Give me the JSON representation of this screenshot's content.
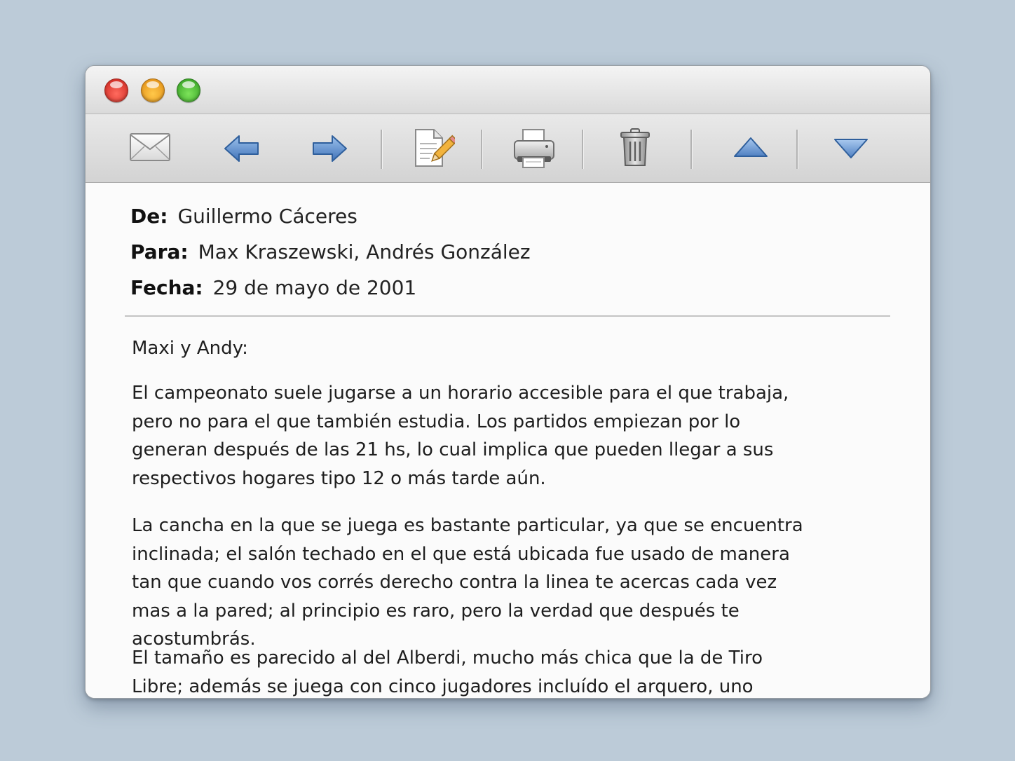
{
  "toolbar": {
    "icons": [
      "mail-icon",
      "arrow-left-icon",
      "arrow-right-icon",
      "compose-icon",
      "printer-icon",
      "trash-icon",
      "arrow-up-icon",
      "arrow-down-icon"
    ]
  },
  "header": {
    "from_label": "De:",
    "from_value": "Guillermo Cáceres",
    "to_label": "Para:",
    "to_value": "Max Kraszewski, Andrés González",
    "date_label": "Fecha:",
    "date_value": "29 de mayo de 2001"
  },
  "message": {
    "greeting": "Maxi y Andy:",
    "paragraphs": [
      "El campeonato suele jugarse a un horario accesible para el que trabaja, pero no para el que también estudia. Los partidos empiezan por lo generan después de las 21 hs, lo cual implica que pueden llegar a sus respectivos hogares tipo 12 o más tarde aún.",
      "La cancha en la que se juega es bastante particular, ya que se encuentra inclinada; el salón techado en el que está ubicada fue usado de manera tan que cuando vos corrés derecho contra la linea te acercas cada vez mas a la pared; al principio es raro, pero la verdad que después te acostumbrás.",
      "El tamaño es parecido al del Alberdi, mucho más chica que la de Tiro Libre; además se juega con cinco jugadores incluído el arquero, uno menos"
    ]
  },
  "colors": {
    "background": "#bccbd8",
    "window": "#fbfbfb",
    "arrow_blue": "#5d8fcc"
  }
}
